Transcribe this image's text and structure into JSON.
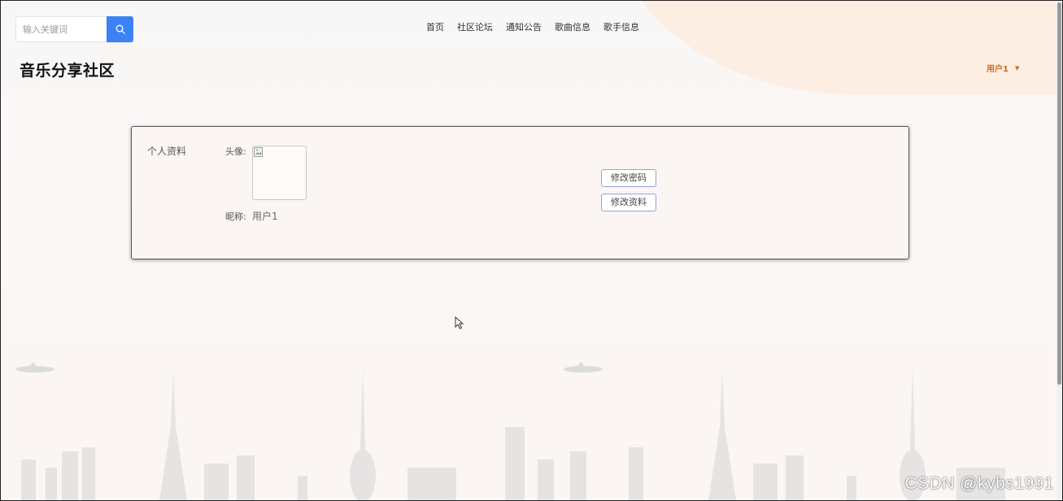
{
  "search": {
    "placeholder": "输入关键词",
    "button_icon": "search-icon"
  },
  "nav": {
    "items": [
      {
        "label": "首页"
      },
      {
        "label": "社区论坛"
      },
      {
        "label": "通知公告"
      },
      {
        "label": "歌曲信息"
      },
      {
        "label": "歌手信息"
      }
    ]
  },
  "header": {
    "site_title": "音乐分享社区",
    "user_name": "用户1",
    "user_caret_icon": "caret-down-icon"
  },
  "profile": {
    "section_label": "个人资料",
    "avatar_label": "头像:",
    "nickname_label": "昵称:",
    "nickname_value": "用户1",
    "change_password_button": "修改密码",
    "edit_profile_button": "修改资料"
  },
  "watermark": "CSDN @kybs1991",
  "colors": {
    "accent_blue": "#3b82f6",
    "user_orange": "#d3651d",
    "button_border": "#8fa6d9",
    "peach": "#fdeee3"
  }
}
